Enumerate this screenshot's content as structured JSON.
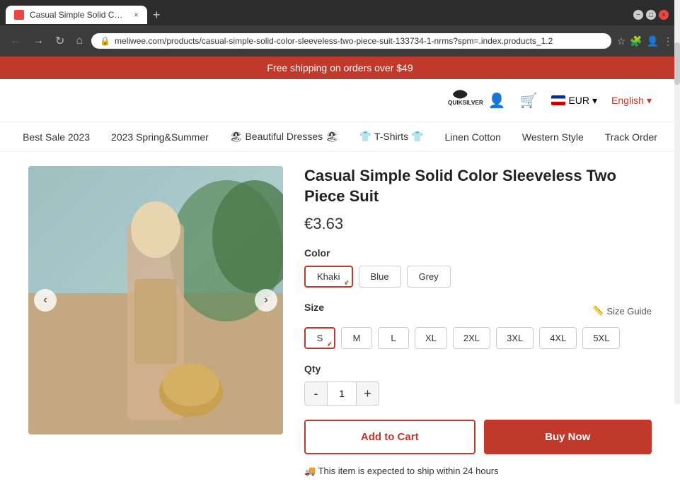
{
  "browser": {
    "tab_title": "Casual Simple Solid Color Sleev...",
    "new_tab_icon": "+",
    "address": "meliwee.com/products/casual-simple-solid-color-sleeveless-two-piece-suit-133734-1-nrms?spm=.index.products_1.2",
    "window_controls": [
      "−",
      "□",
      "×"
    ]
  },
  "promo_bar": {
    "text": "Free shipping on orders over $49"
  },
  "header": {
    "logo_alt": "Quiksilver",
    "currency_flag": "EU",
    "currency": "EUR",
    "currency_arrow": "▾",
    "language": "English",
    "language_arrow": "▾"
  },
  "nav": {
    "items": [
      "Best Sale 2023",
      "2023 Spring&Summer",
      "🏖 Beautiful Dresses 🏖",
      "👕 T-Shirts 👕",
      "Linen Cotton",
      "Western Style",
      "Track Order"
    ]
  },
  "product": {
    "title": "Casual Simple Solid Color Sleeveless Two Piece Suit",
    "price": "€3.63",
    "color_label": "Color",
    "colors": [
      {
        "name": "Khaki",
        "selected": true
      },
      {
        "name": "Blue",
        "selected": false
      },
      {
        "name": "Grey",
        "selected": false
      }
    ],
    "size_label": "Size",
    "size_guide": "Size Guide",
    "sizes": [
      {
        "name": "S",
        "selected": true
      },
      {
        "name": "M",
        "selected": false
      },
      {
        "name": "L",
        "selected": false
      },
      {
        "name": "XL",
        "selected": false
      },
      {
        "name": "2XL",
        "selected": false
      },
      {
        "name": "3XL",
        "selected": false
      },
      {
        "name": "4XL",
        "selected": false
      },
      {
        "name": "5XL",
        "selected": false
      }
    ],
    "qty_label": "Qty",
    "qty_minus": "-",
    "qty_value": "1",
    "qty_plus": "+",
    "add_to_cart": "Add to Cart",
    "buy_now": "Buy Now",
    "shipping_info": "🚚 This item is expected to ship within 24 hours"
  }
}
